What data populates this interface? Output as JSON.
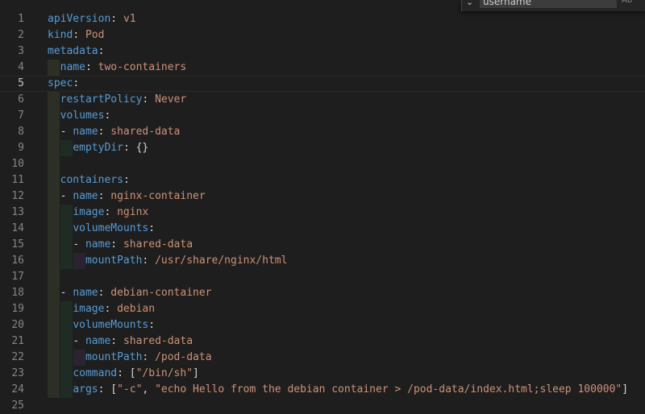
{
  "find_widget": {
    "query": "username",
    "toggle_glyph": "⌄",
    "option_label": "Ab"
  },
  "editor": {
    "active_line": 5,
    "lines": [
      {
        "n": "1",
        "indent": 0,
        "tokens": [
          [
            "k",
            "apiVersion"
          ],
          [
            "p",
            ": "
          ],
          [
            "v",
            "v1"
          ]
        ]
      },
      {
        "n": "2",
        "indent": 0,
        "tokens": [
          [
            "k",
            "kind"
          ],
          [
            "p",
            ": "
          ],
          [
            "v",
            "Pod"
          ]
        ]
      },
      {
        "n": "3",
        "indent": 0,
        "tokens": [
          [
            "k",
            "metadata"
          ],
          [
            "p",
            ":"
          ]
        ]
      },
      {
        "n": "4",
        "indent": 1,
        "tokens": [
          [
            "k",
            "name"
          ],
          [
            "p",
            ": "
          ],
          [
            "v",
            "two-containers"
          ]
        ]
      },
      {
        "n": "5",
        "indent": 0,
        "tokens": [
          [
            "k",
            "spec"
          ],
          [
            "p",
            ":"
          ]
        ]
      },
      {
        "n": "6",
        "indent": 1,
        "tokens": [
          [
            "k",
            "restartPolicy"
          ],
          [
            "p",
            ": "
          ],
          [
            "v",
            "Never"
          ]
        ]
      },
      {
        "n": "7",
        "indent": 1,
        "tokens": [
          [
            "k",
            "volumes"
          ],
          [
            "p",
            ":"
          ]
        ]
      },
      {
        "n": "8",
        "indent": 1,
        "tokens": [
          [
            "p",
            "- "
          ],
          [
            "k",
            "name"
          ],
          [
            "p",
            ": "
          ],
          [
            "v",
            "shared-data"
          ]
        ]
      },
      {
        "n": "9",
        "indent": 2,
        "tokens": [
          [
            "k",
            "emptyDir"
          ],
          [
            "p",
            ": {}"
          ]
        ]
      },
      {
        "n": "10",
        "indent": 1,
        "tokens": []
      },
      {
        "n": "11",
        "indent": 1,
        "tokens": [
          [
            "k",
            "containers"
          ],
          [
            "p",
            ":"
          ]
        ]
      },
      {
        "n": "12",
        "indent": 1,
        "tokens": [
          [
            "p",
            "- "
          ],
          [
            "k",
            "name"
          ],
          [
            "p",
            ": "
          ],
          [
            "v",
            "nginx-container"
          ]
        ]
      },
      {
        "n": "13",
        "indent": 2,
        "tokens": [
          [
            "k",
            "image"
          ],
          [
            "p",
            ": "
          ],
          [
            "v",
            "nginx"
          ]
        ]
      },
      {
        "n": "14",
        "indent": 2,
        "tokens": [
          [
            "k",
            "volumeMounts"
          ],
          [
            "p",
            ":"
          ]
        ]
      },
      {
        "n": "15",
        "indent": 2,
        "tokens": [
          [
            "p",
            "- "
          ],
          [
            "k",
            "name"
          ],
          [
            "p",
            ": "
          ],
          [
            "v",
            "shared-data"
          ]
        ]
      },
      {
        "n": "16",
        "indent": 3,
        "tokens": [
          [
            "k",
            "mountPath"
          ],
          [
            "p",
            ": "
          ],
          [
            "v",
            "/usr/share/nginx/html"
          ]
        ]
      },
      {
        "n": "17",
        "indent": 1,
        "tokens": []
      },
      {
        "n": "18",
        "indent": 1,
        "tokens": [
          [
            "p",
            "- "
          ],
          [
            "k",
            "name"
          ],
          [
            "p",
            ": "
          ],
          [
            "v",
            "debian-container"
          ]
        ]
      },
      {
        "n": "19",
        "indent": 2,
        "tokens": [
          [
            "k",
            "image"
          ],
          [
            "p",
            ": "
          ],
          [
            "v",
            "debian"
          ]
        ]
      },
      {
        "n": "20",
        "indent": 2,
        "tokens": [
          [
            "k",
            "volumeMounts"
          ],
          [
            "p",
            ":"
          ]
        ]
      },
      {
        "n": "21",
        "indent": 2,
        "tokens": [
          [
            "p",
            "- "
          ],
          [
            "k",
            "name"
          ],
          [
            "p",
            ": "
          ],
          [
            "v",
            "shared-data"
          ]
        ]
      },
      {
        "n": "22",
        "indent": 3,
        "tokens": [
          [
            "k",
            "mountPath"
          ],
          [
            "p",
            ": "
          ],
          [
            "v",
            "/pod-data"
          ]
        ]
      },
      {
        "n": "23",
        "indent": 2,
        "tokens": [
          [
            "k",
            "command"
          ],
          [
            "p",
            ": ["
          ],
          [
            "v",
            "\"/bin/sh\""
          ],
          [
            "p",
            "]"
          ]
        ]
      },
      {
        "n": "24",
        "indent": 2,
        "tokens": [
          [
            "k",
            "args"
          ],
          [
            "p",
            ": ["
          ],
          [
            "v",
            "\"-c\""
          ],
          [
            "p",
            ", "
          ],
          [
            "v",
            "\"echo Hello from the debian container > /pod-data/index.html;sleep 100000\""
          ],
          [
            "p",
            "]"
          ]
        ]
      },
      {
        "n": "25",
        "indent": 0,
        "tokens": []
      }
    ]
  },
  "colors": {
    "background": "#1e1e1e",
    "key": "#569cd6",
    "string": "#ce9178",
    "punctuation": "#d4d4d4",
    "line_number": "#858585"
  }
}
